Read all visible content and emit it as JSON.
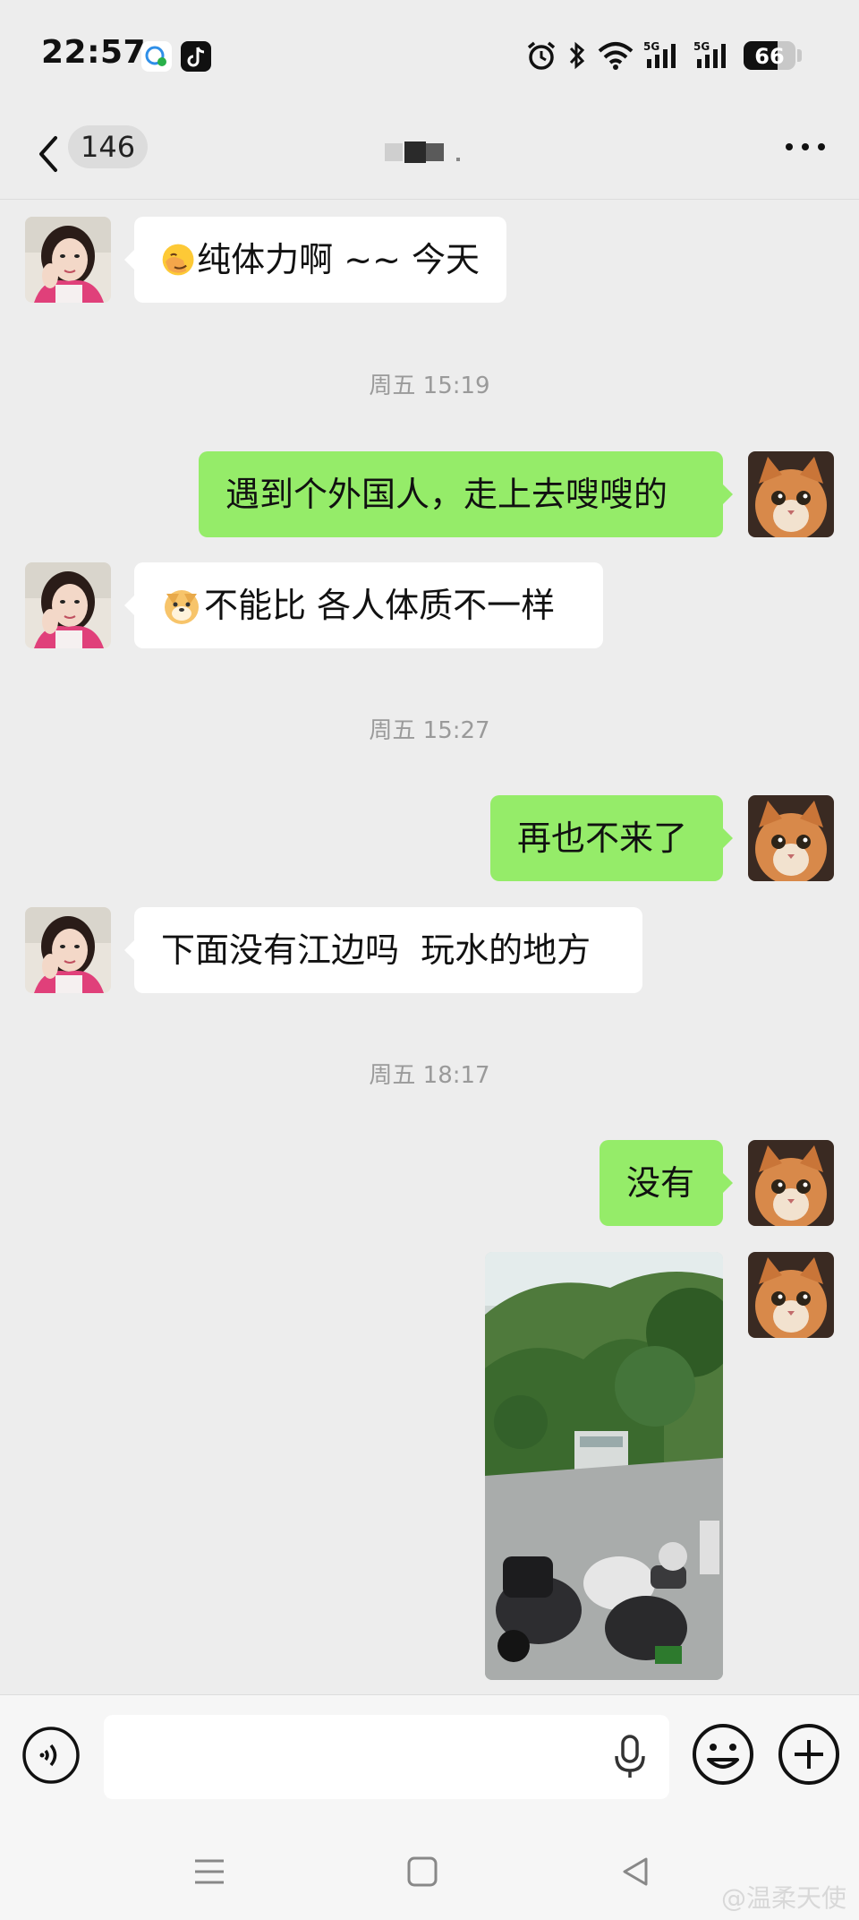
{
  "status_bar": {
    "time": "22:57",
    "icons": [
      "chat-app-icon",
      "douyin-icon",
      "alarm-icon",
      "bluetooth-icon",
      "wifi-icon",
      "signal-5g-icon",
      "signal-5g-icon"
    ],
    "signal_labels": [
      "5G",
      "5G"
    ],
    "battery_text": "66",
    "battery_level": 0.66
  },
  "header": {
    "unread_count": "146",
    "title": ""
  },
  "messages": [
    {
      "side": "in",
      "emoji": "facepalm",
      "text": "纯体力啊 ~~ 今天"
    },
    {
      "type": "timestamp",
      "text": "周五 15:19"
    },
    {
      "side": "out",
      "text": "遇到个外国人，走上去嗖嗖的"
    },
    {
      "side": "in",
      "emoji": "doge",
      "text": "不能比 各人体质不一样"
    },
    {
      "type": "timestamp",
      "text": "周五 15:27"
    },
    {
      "side": "out",
      "text": "再也不来了"
    },
    {
      "side": "in",
      "text": "下面没有江边吗  玩水的地方"
    },
    {
      "type": "timestamp",
      "text": "周五 18:17"
    },
    {
      "side": "out",
      "text": "没有"
    },
    {
      "side": "out",
      "type": "image",
      "description": "scooters parked under trees"
    }
  ],
  "input": {
    "placeholder": "",
    "value": ""
  },
  "colors": {
    "background": "#ededed",
    "bubble_in": "#ffffff",
    "bubble_out": "#95ec69",
    "timestamp": "#9a9a9a"
  },
  "watermark": "@温柔天使"
}
